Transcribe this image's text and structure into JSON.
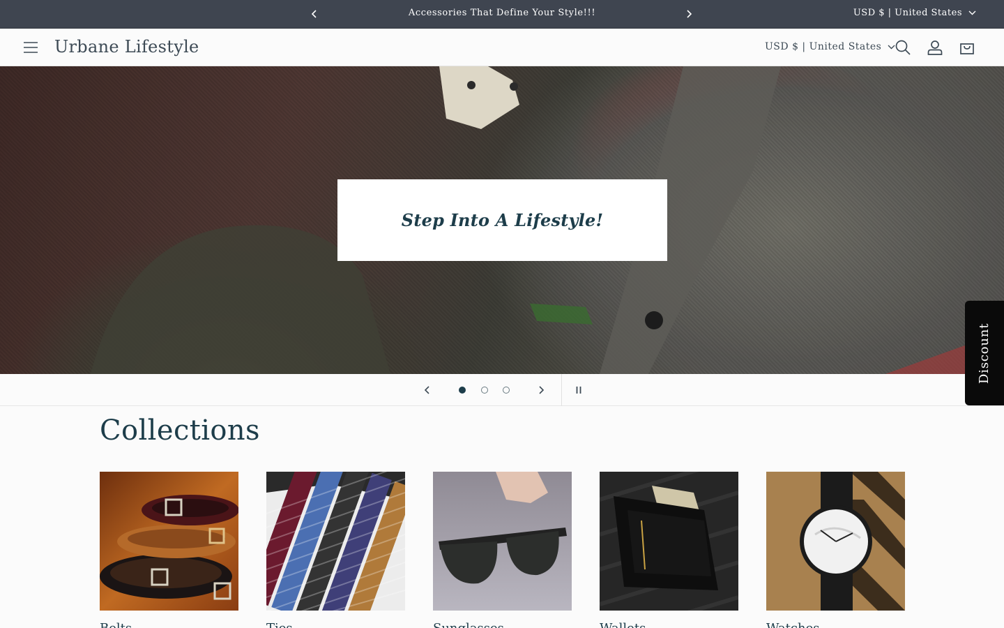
{
  "announcement": {
    "message": "Accessories That Define Your Style!!!",
    "locale": "USD $ | United States"
  },
  "header": {
    "brand": "Urbane Lifestyle",
    "locale": "USD $ | United States"
  },
  "hero": {
    "caption": "Step Into A Lifestyle!",
    "total_slides": 3,
    "active_slide": 1
  },
  "discount_tab": {
    "label": "Discount"
  },
  "collections": {
    "title": "Collections",
    "items": [
      {
        "label": "Belts",
        "image": "belts-image"
      },
      {
        "label": "Ties",
        "image": "ties-image"
      },
      {
        "label": "Sunglasses",
        "image": "sunglasses-image"
      },
      {
        "label": "Wallets",
        "image": "wallets-image"
      },
      {
        "label": "Watches",
        "image": "watches-image"
      }
    ]
  },
  "icons": {
    "menu": "hamburger-menu-icon",
    "search": "search-icon",
    "account": "account-icon",
    "cart": "cart-bag-icon",
    "prev": "chevron-left-icon",
    "next": "chevron-right-icon",
    "dropdown": "chevron-down-icon",
    "pause": "pause-icon"
  },
  "colors": {
    "announcement_bg": "#3f4550",
    "primary_text": "#1d3d4a",
    "discount_bg": "#0a0a0a"
  }
}
